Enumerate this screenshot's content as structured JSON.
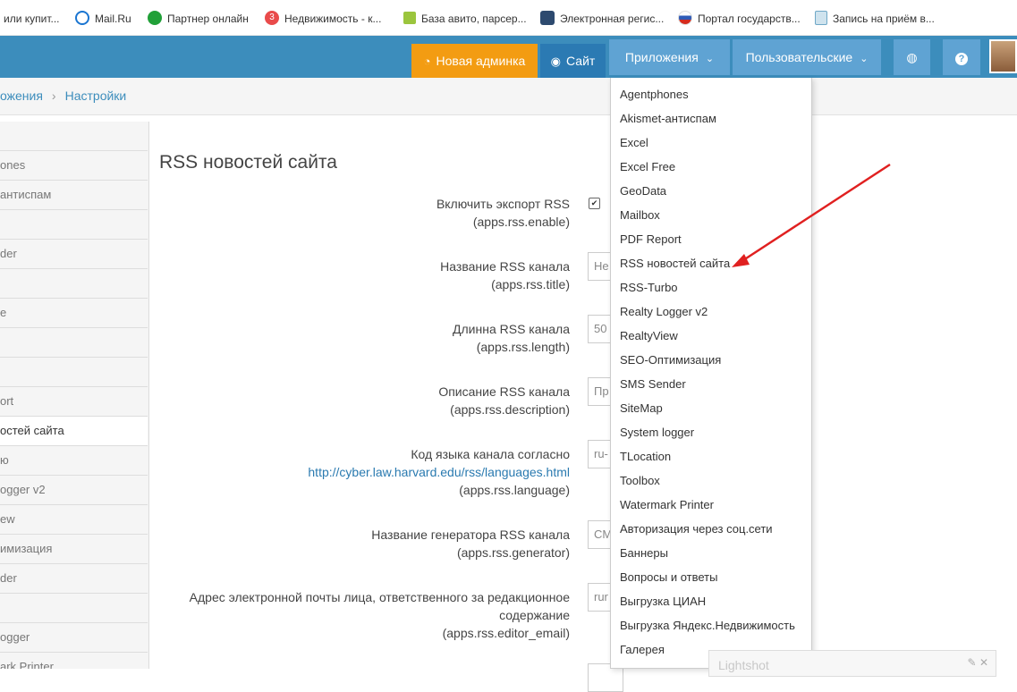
{
  "bookmarks": [
    {
      "label": "или купит...",
      "icon": "page-icon",
      "color": "#bbbbbb"
    },
    {
      "label": "Mail.Ru",
      "icon": "mailru-icon",
      "color": "#1a75d1"
    },
    {
      "label": "Партнер онлайн",
      "icon": "sber-icon",
      "color": "#21a038"
    },
    {
      "label": "Недвижимость - к...",
      "icon": "yandex-icon",
      "color": "#e94b4b"
    },
    {
      "label": "База авито, парсер...",
      "icon": "blocks-icon",
      "color": "#9bc53d"
    },
    {
      "label": "Электронная регис...",
      "icon": "registry-icon",
      "color": "#2d4a6f"
    },
    {
      "label": "Портал государств...",
      "icon": "russia-flag-icon",
      "color": "#d52b1e"
    },
    {
      "label": "Запись на приём в...",
      "icon": "doc-icon",
      "color": "#6fa8c7"
    }
  ],
  "topnav": {
    "admin_label": "Новая админка",
    "site_label": "Сайт",
    "apps_label": "Приложения",
    "user_label": "Пользовательские",
    "globe_glyph": "◍",
    "help_glyph": "?",
    "brand_color": "#3c8dbc",
    "admin_color": "#f39c12"
  },
  "breadcrumb": {
    "parent": "ожения",
    "current": "Настройки"
  },
  "sidebar": {
    "items": [
      {
        "label": ""
      },
      {
        "label": "ones"
      },
      {
        "label": "антиспам"
      },
      {
        "label": ""
      },
      {
        "label": "der"
      },
      {
        "label": ""
      },
      {
        "label": "e"
      },
      {
        "label": ""
      },
      {
        "label": ""
      },
      {
        "label": "ort"
      },
      {
        "label": "остей сайта",
        "active": true
      },
      {
        "label": "ю"
      },
      {
        "label": "ogger v2"
      },
      {
        "label": "ew"
      },
      {
        "label": "имизация"
      },
      {
        "label": "der"
      },
      {
        "label": ""
      },
      {
        "label": "ogger"
      },
      {
        "label": "ark Printer"
      }
    ]
  },
  "page": {
    "title": "RSS новостей сайта",
    "fields": [
      {
        "label": "Включить экспорт RSS",
        "key": "(apps.rss.enable)",
        "value": "✔"
      },
      {
        "label": "Название RSS канала",
        "key": "(apps.rss.title)",
        "value": "Не"
      },
      {
        "label": "Длинна RSS канала",
        "key": "(apps.rss.length)",
        "value": "50"
      },
      {
        "label": "Описание RSS канала",
        "key": "(apps.rss.description)",
        "value": "Пр"
      },
      {
        "label": "Код языка канала согласно",
        "link": "http://cyber.law.harvard.edu/rss/languages.html",
        "key": "(apps.rss.language)",
        "value": "ru-"
      },
      {
        "label": "Название генератора RSS канала",
        "key": "(apps.rss.generator)",
        "value": "CM"
      },
      {
        "label": "Адрес электронной почты лица, ответственного за редакционное",
        "label2": "содержание",
        "key": "(apps.rss.editor_email)",
        "value": "rur"
      }
    ]
  },
  "apps_menu": {
    "items": [
      "Agentphones",
      "Akismet-антиспам",
      "Excel",
      "Excel Free",
      "GeoData",
      "Mailbox",
      "PDF Report",
      "RSS новостей сайта",
      "RSS-Turbo",
      "Realty Logger v2",
      "RealtyView",
      "SEO-Оптимизация",
      "SMS Sender",
      "SiteMap",
      "System logger",
      "TLocation",
      "Toolbox",
      "Watermark Printer",
      "Авторизация через соц.сети",
      "Баннеры",
      "Вопросы и ответы",
      "Выгрузка ЦИАН",
      "Выгрузка Яндекс.Недвижимость",
      "Галерея"
    ]
  },
  "lightshot": {
    "label": "Lightshot"
  },
  "annotation": {
    "arrow_color": "#e02020"
  }
}
